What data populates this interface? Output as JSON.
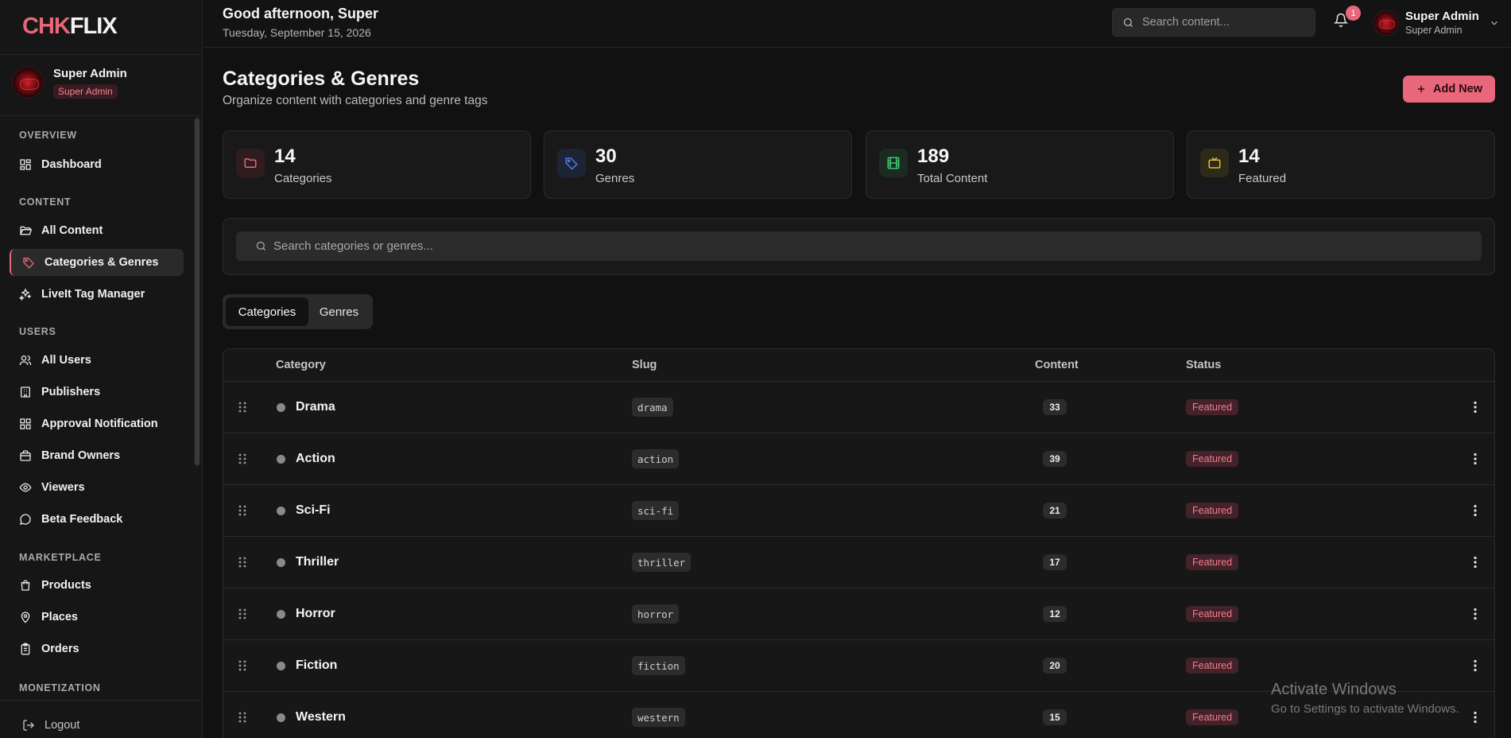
{
  "brand": {
    "logo_part1": "CHK",
    "logo_part2": "FLIX",
    "accent": "#e8677a"
  },
  "sidebar": {
    "user": {
      "name": "Super Admin",
      "role": "Super Admin"
    },
    "sections": {
      "overview": "OVERVIEW",
      "content": "CONTENT",
      "users": "USERS",
      "marketplace": "MARKETPLACE",
      "monetization": "MONETIZATION"
    },
    "items": {
      "dashboard": {
        "label": "Dashboard",
        "icon": "dashboard-grid-icon"
      },
      "all_content": {
        "label": "All Content",
        "icon": "folder-open-icon"
      },
      "categories": {
        "label": "Categories & Genres",
        "icon": "tag-icon",
        "active": true
      },
      "tag_manager": {
        "label": "LiveIt Tag Manager",
        "icon": "sparkles-icon"
      },
      "all_users": {
        "label": "All Users",
        "icon": "users-icon"
      },
      "publishers": {
        "label": "Publishers",
        "icon": "building-icon"
      },
      "approval": {
        "label": "Approval Notification",
        "icon": "grid-icon"
      },
      "brand_owners": {
        "label": "Brand Owners",
        "icon": "briefcase-icon"
      },
      "viewers": {
        "label": "Viewers",
        "icon": "eye-icon"
      },
      "beta_feedback": {
        "label": "Beta Feedback",
        "icon": "message-circle-icon"
      },
      "products": {
        "label": "Products",
        "icon": "shopping-bag-icon"
      },
      "places": {
        "label": "Places",
        "icon": "map-pin-icon"
      },
      "orders": {
        "label": "Orders",
        "icon": "clipboard-list-icon"
      }
    },
    "logout": "Logout"
  },
  "topbar": {
    "greeting": "Good afternoon, Super",
    "date": "Tuesday, September 15, 2026",
    "search_placeholder": "Search content...",
    "notification_count": "1",
    "user_name": "Super Admin",
    "user_role": "Super Admin"
  },
  "page": {
    "title": "Categories & Genres",
    "subtitle": "Organize content with categories and genre tags",
    "add_button": "Add New"
  },
  "stats": [
    {
      "value": "14",
      "label": "Categories",
      "icon": "folder-icon",
      "color": "#e8677a"
    },
    {
      "value": "30",
      "label": "Genres",
      "icon": "tag-icon",
      "color": "#4f7cf0"
    },
    {
      "value": "189",
      "label": "Total Content",
      "icon": "film-icon",
      "color": "#3ec46d"
    },
    {
      "value": "14",
      "label": "Featured",
      "icon": "tv-icon",
      "color": "#e6c02a"
    }
  ],
  "filter": {
    "search_placeholder": "Search categories or genres..."
  },
  "tabs": [
    {
      "label": "Categories",
      "active": true
    },
    {
      "label": "Genres",
      "active": false
    }
  ],
  "table": {
    "headers": {
      "category": "Category",
      "slug": "Slug",
      "content": "Content",
      "status": "Status"
    },
    "rows": [
      {
        "name": "Drama",
        "slug": "drama",
        "count": "33",
        "status": "Featured"
      },
      {
        "name": "Action",
        "slug": "action",
        "count": "39",
        "status": "Featured"
      },
      {
        "name": "Sci-Fi",
        "slug": "sci-fi",
        "count": "21",
        "status": "Featured"
      },
      {
        "name": "Thriller",
        "slug": "thriller",
        "count": "17",
        "status": "Featured"
      },
      {
        "name": "Horror",
        "slug": "horror",
        "count": "12",
        "status": "Featured"
      },
      {
        "name": "Fiction",
        "slug": "fiction",
        "count": "20",
        "status": "Featured"
      },
      {
        "name": "Western",
        "slug": "western",
        "count": "15",
        "status": "Featured"
      }
    ]
  },
  "watermark": {
    "line1": "Activate Windows",
    "line2": "Go to Settings to activate Windows."
  }
}
